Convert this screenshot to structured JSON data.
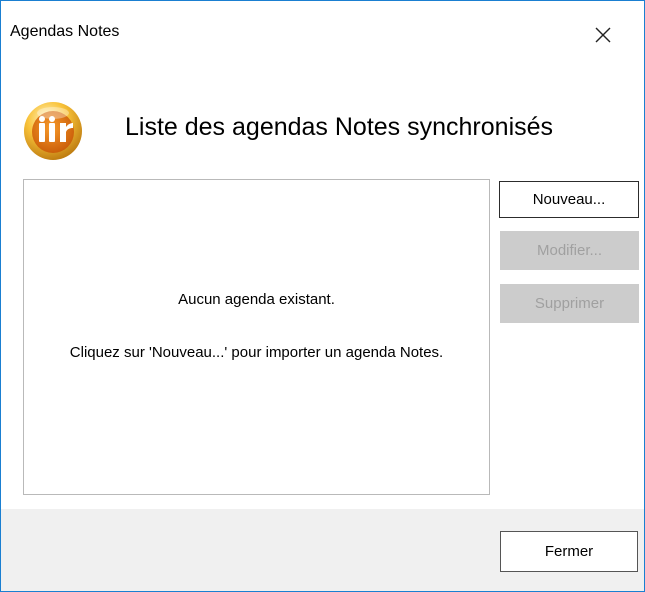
{
  "window": {
    "title": "Agendas Notes"
  },
  "header": {
    "title": "Liste des agendas Notes synchronisés",
    "icon": "ibm-notes-logo-icon",
    "icon_text": "iii"
  },
  "list": {
    "empty_message": "Aucun agenda existant.",
    "hint_message": "Cliquez sur 'Nouveau...' pour importer un agenda Notes."
  },
  "buttons": {
    "new_label": "Nouveau...",
    "edit_label": "Modifier...",
    "delete_label": "Supprimer",
    "close_label": "Fermer"
  },
  "colors": {
    "accent": "#1a7fd1",
    "logo_outer": "#f6b31c",
    "logo_inner": "#e0730e"
  }
}
